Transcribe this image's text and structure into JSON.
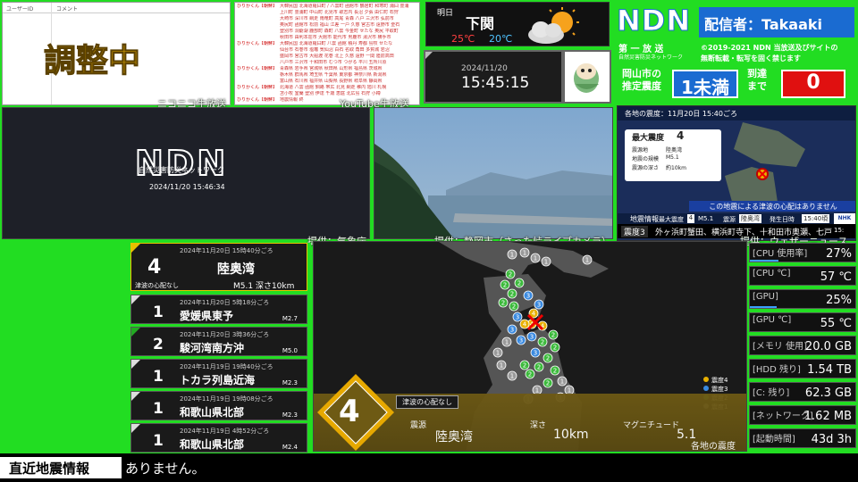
{
  "niconico": {
    "col_user": "ユーザーID",
    "col_comment": "コメント",
    "status": "調整中",
    "caption": "ニコニコ生放送"
  },
  "youtube": {
    "caption": "YouTube生放送",
    "lines": [
      {
        "user": "ひりかくん【朝鮮】",
        "msg": "大韓民国 北海道羅臼町 / 八雲町 函館市 鶴居町 和寒町 浦臼 豊浦"
      },
      {
        "user": "",
        "msg": "上川町 豊浦町 中山町 北見市 歌志内 長沼 夕張 由仁町 石狩"
      },
      {
        "user": "",
        "msg": "大崎市 深川市 網走 雨竜町 高尾 青森 八戸 三沢市 弘前市"
      },
      {
        "user": "",
        "msg": "奥尻町 函館市 松前 福山 江差 一戸 久慈 宮古市 遠野市 釜石"
      },
      {
        "user": "",
        "msg": "登別市 洞爺湖 鹿部町 森町 八雲 今金町 せたな 奥尻 平取町"
      },
      {
        "user": "",
        "msg": "秋田市 由利本荘市 大館市 能代市 男鹿市 湯沢市 横手市"
      },
      {
        "user": "ひりかくん【朝鮮】",
        "msg": "大韓民国 北海道羅臼町 八雲 函館 積丹 寿都 島牧 せたな"
      },
      {
        "user": "",
        "msg": "仙台市 石巻市 塩竈 気仙沼 白石 名取 角田 多賀城 岩沼"
      },
      {
        "user": "",
        "msg": "盛岡市 宮古市 大船渡 花巻 北上 久慈 遠野 一関 陸前高田"
      },
      {
        "user": "",
        "msg": "八戸市 三沢市 十和田市 むつ市 つがる 平川 五所川原"
      },
      {
        "user": "ひりかくん【朝鮮】",
        "msg": "青森県 岩手県 宮城県 秋田県 山形県 福島県 茨城県"
      },
      {
        "user": "",
        "msg": "栃木県 群馬県 埼玉県 千葉県 東京都 神奈川県 新潟県"
      },
      {
        "user": "",
        "msg": "富山県 石川県 福井県 山梨県 長野県 岐阜県 静岡県"
      },
      {
        "user": "ひりかくん【朝鮮】",
        "msg": "北海道 八雲 函館 釧路 帯広 北見 網走 稚内 旭川 札幌"
      },
      {
        "user": "",
        "msg": "苫小牧 室蘭 登別 伊達 千歳 恵庭 北広島 石狩 小樽"
      },
      {
        "user": "ひりかくん【朝鮮】",
        "msg": "地震情報 終"
      }
    ]
  },
  "weather": {
    "day": "明日",
    "city": "下関",
    "high": "25℃",
    "low": "20℃"
  },
  "clock": {
    "date": "2024/11/20",
    "time": "15:45:15"
  },
  "ndn": {
    "logo": "NDN",
    "caster": "配信者：Takaaki",
    "broadcast": "第 一 放 送",
    "org": "自然災害防災ネットワーク",
    "copyright": "©2019-2021 NDN 当放送及びサイトの",
    "copyright2": "無断転載・転写を固く禁じます",
    "est_label_1": "岡山市の",
    "est_label_2": "推定震度",
    "est_value": "1未満",
    "arrive_label_1": "到達",
    "arrive_label_2": "まで",
    "arrive_value": "0"
  },
  "logo_panel": {
    "logo": "NDN",
    "subtitle": "自然災害防災ネットワーク",
    "datetime": "2024/11/20 15:46:34",
    "caption": "提供：気象庁"
  },
  "camera": {
    "caption": "提供：静岡市（さった峠ライブカメラ）"
  },
  "intensity_panel": {
    "header": "各地の震度：11月20日 15:40ごろ",
    "max_label": "最大震度",
    "max_value": "4",
    "f1_label": "震源地",
    "f1_value": "陸奥湾",
    "f2_label": "地震の規模",
    "f2_value": "M5.1",
    "f3_label": "震源の深さ",
    "f3_value": "約10km",
    "banner": "この地震による津波の心配はありません",
    "info_label": "地震情報",
    "sum_max": "最大震度",
    "sum_max_v": "4",
    "sum_m": "M5.1",
    "sum_loc_l": "震源",
    "sum_loc": "陸奥湾",
    "sum_time_l": "発生日時",
    "sum_time": "15:40頃",
    "ticker_l": "震度3",
    "ticker": "外ヶ浜町蟹田、横浜町寺下、十和田市奥瀬、七戸",
    "corner_logo": "NHK",
    "corner_time": "15:",
    "caption": "提供：ウェザーニュース"
  },
  "quake_list": [
    {
      "date": "2024年11月20日 15時40分ごろ",
      "scale": "4",
      "loc": "陸奥湾",
      "mag": "M5.1 深さ10km",
      "tsunami": "津波の心配なし",
      "color": "#e8c000"
    },
    {
      "date": "2024年11月20日 5時18分ごろ",
      "scale": "1",
      "loc": "愛媛県東予",
      "mag": "M2.7",
      "color": "#dddddd"
    },
    {
      "date": "2024年11月20日 3時36分ごろ",
      "scale": "2",
      "loc": "駿河湾南方沖",
      "mag": "M5.0",
      "color": "#22aa22"
    },
    {
      "date": "2024年11月19日 19時40分ごろ",
      "scale": "1",
      "loc": "トカラ列島近海",
      "mag": "M2.3",
      "color": "#dddddd"
    },
    {
      "date": "2024年11月19日 19時08分ごろ",
      "scale": "1",
      "loc": "和歌山県北部",
      "mag": "M2.3",
      "color": "#dddddd"
    },
    {
      "date": "2024年11月19日 4時52分ごろ",
      "scale": "1",
      "loc": "和歌山県北部",
      "mag": "M2.4",
      "color": "#dddddd"
    }
  ],
  "map": {
    "tsunami": "津波の心配なし",
    "scale": "4",
    "f_epi": "震源",
    "f_epi_v": "陸奥湾",
    "f_depth": "深さ",
    "f_depth_v": "10km",
    "f_mag": "マグニチュード",
    "f_mag_v": "5.1",
    "caption": "各地の震度",
    "legend": [
      {
        "label": "震度4",
        "color": "#e8b000"
      },
      {
        "label": "震度3",
        "color": "#3a8ae0"
      },
      {
        "label": "震度2",
        "color": "#3cba3c"
      },
      {
        "label": "震度1",
        "color": "#9a9a9a"
      }
    ]
  },
  "stats": [
    {
      "label": "[CPU 使用率]",
      "value": "27%",
      "bar": 0.27
    },
    {
      "label": "[CPU ℃]",
      "value": "57 ℃"
    },
    {
      "label": "[GPU]",
      "value": "25%",
      "bar": 0.25
    },
    {
      "label": "[GPU ℃]",
      "value": "55 ℃"
    },
    {
      "label": "[メモリ 使用]",
      "value": "20.0 GB"
    },
    {
      "label": "[HDD 残り]",
      "value": "1.54 TB"
    },
    {
      "label": "[C: 残り]",
      "value": "62.3 GB"
    },
    {
      "label": "[ネットワーク]",
      "value": "1.62 MB"
    },
    {
      "label": "[起動時間]",
      "value": "43d 3h"
    }
  ],
  "ticker": {
    "label": "直近地震情報",
    "text": "ありません。"
  }
}
